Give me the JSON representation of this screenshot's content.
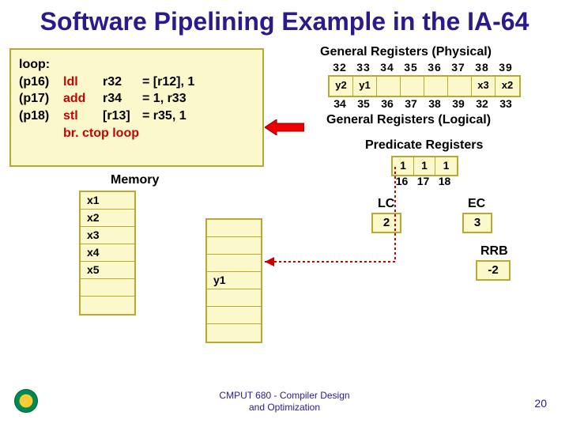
{
  "title": "Software Pipelining Example in the IA-64",
  "code": {
    "label_loop": "loop:",
    "pred0": "(p16)",
    "inst0": "ldl",
    "arg0a": "r32",
    "arg0b": "= [r12], 1",
    "pred1": "(p17)",
    "inst1": "add",
    "arg1a": "r34",
    "arg1b": "= 1, r33",
    "pred2": "(p18)",
    "inst2": "stl",
    "arg2c": "[r13]",
    "arg2b": "= r35, 1",
    "inst3": "br. ctop loop"
  },
  "memory": {
    "label": "Memory",
    "left": [
      "x1",
      "x2",
      "x3",
      "x4",
      "x5",
      "",
      ""
    ],
    "right": [
      "",
      "",
      "",
      "y1",
      "",
      "",
      ""
    ]
  },
  "registers": {
    "phys_label": "General Registers (Physical)",
    "phys_indices": [
      "32",
      "33",
      "34",
      "35",
      "36",
      "37",
      "38",
      "39"
    ],
    "values": [
      "y2",
      "y1",
      "",
      "",
      "",
      "",
      "x3",
      "x2"
    ],
    "log_indices": [
      "34",
      "35",
      "36",
      "37",
      "38",
      "39",
      "32",
      "33"
    ],
    "log_label": "General Registers (Logical)"
  },
  "predicates": {
    "label": "Predicate Registers",
    "values": [
      "1",
      "1",
      "1"
    ],
    "indices": [
      "16",
      "17",
      "18"
    ]
  },
  "lc": {
    "label": "LC",
    "value": "2"
  },
  "ec": {
    "label": "EC",
    "value": "3"
  },
  "rrb": {
    "label": "RRB",
    "value": "-2"
  },
  "footer": {
    "course": "CMPUT 680 - Compiler Design\nand Optimization",
    "slide": "20"
  }
}
